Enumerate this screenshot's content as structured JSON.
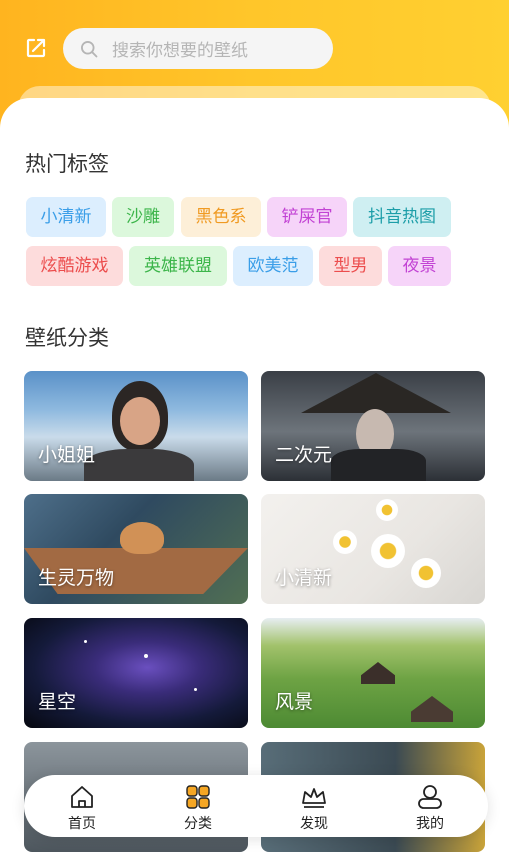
{
  "header": {
    "search_placeholder": "搜索你想要的壁纸",
    "edit_icon": "edit-icon",
    "search_icon": "search-icon"
  },
  "hot_tags": {
    "title": "热门标签",
    "tags": [
      {
        "label": "小清新",
        "bg": "#dceefe",
        "color": "#3a9ee8"
      },
      {
        "label": "沙雕",
        "bg": "#dcf8dc",
        "color": "#3cb54a"
      },
      {
        "label": "黑色系",
        "bg": "#fdefd8",
        "color": "#f09a22"
      },
      {
        "label": "铲屎官",
        "bg": "#f6d4f9",
        "color": "#c243d4"
      },
      {
        "label": "抖音热图",
        "bg": "#cfeff2",
        "color": "#1d9ea8"
      },
      {
        "label": "炫酷游戏",
        "bg": "#fddcdc",
        "color": "#ec4d4d"
      },
      {
        "label": "英雄联盟",
        "bg": "#dcf8dc",
        "color": "#3cb54a"
      },
      {
        "label": "欧美范",
        "bg": "#dceefe",
        "color": "#3a9ee8"
      },
      {
        "label": "型男",
        "bg": "#fddcdc",
        "color": "#ec4d4d"
      },
      {
        "label": "夜景",
        "bg": "#f6d4f9",
        "color": "#c243d4"
      }
    ]
  },
  "categories": {
    "title": "壁纸分类",
    "items": [
      {
        "label": "小姐姐"
      },
      {
        "label": "二次元"
      },
      {
        "label": "生灵万物"
      },
      {
        "label": "小清新"
      },
      {
        "label": "星空"
      },
      {
        "label": "风景"
      },
      {
        "label": ""
      },
      {
        "label": ""
      }
    ]
  },
  "tabbar": {
    "items": [
      {
        "label": "首页",
        "icon": "home-icon"
      },
      {
        "label": "分类",
        "icon": "category-icon"
      },
      {
        "label": "发现",
        "icon": "crown-icon"
      },
      {
        "label": "我的",
        "icon": "user-icon"
      }
    ]
  },
  "colors": {
    "header_gradient_start": "#ffb41f",
    "header_gradient_end": "#ffd031",
    "accent": "#f5a623"
  }
}
